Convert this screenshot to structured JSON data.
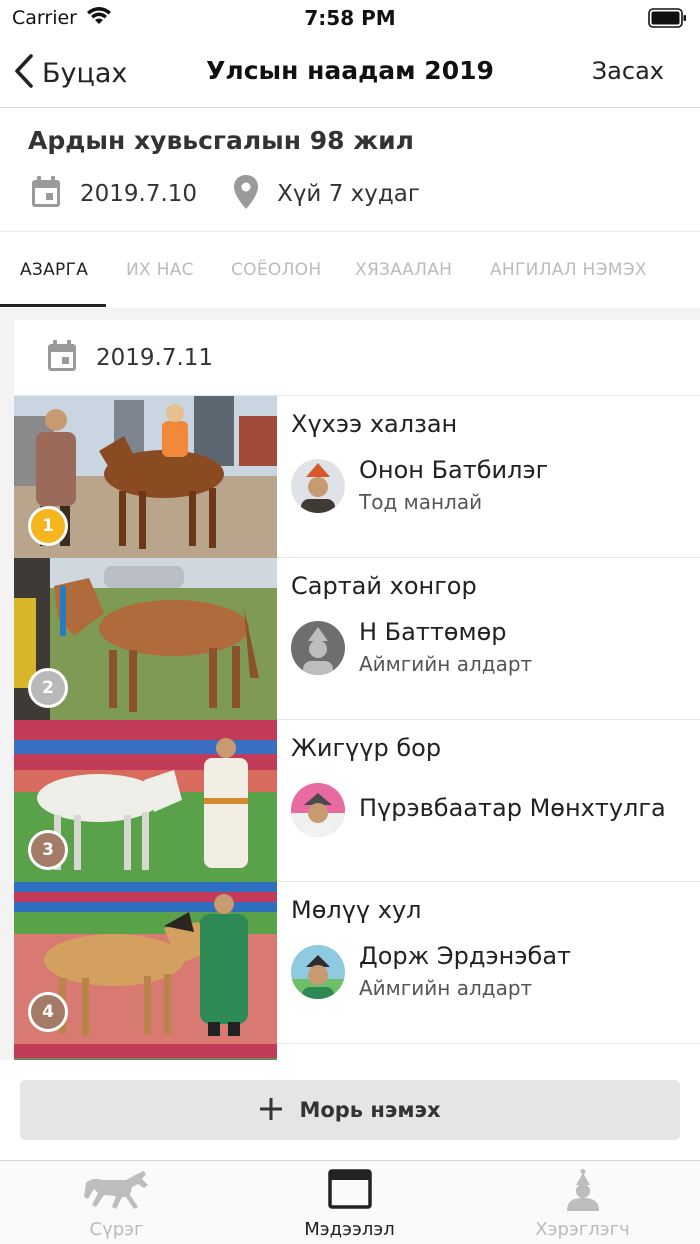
{
  "status_bar": {
    "carrier": "Carrier",
    "time": "7:58 PM"
  },
  "nav": {
    "back_label": "Буцах",
    "title": "Улсын наадам 2019",
    "edit_label": "Засах"
  },
  "event": {
    "title": "Ардын хувьсгалын 98 жил",
    "date": "2019.7.10",
    "location": "Хүй 7 худаг"
  },
  "tabs": [
    {
      "label": "АЗАРГА",
      "active": true
    },
    {
      "label": "ИХ НАС",
      "active": false
    },
    {
      "label": "СОЁОЛОН",
      "active": false
    },
    {
      "label": "ХЯЗААЛАН",
      "active": false
    },
    {
      "label": "АНГИЛАЛ НЭМЭХ",
      "active": false
    }
  ],
  "race": {
    "date": "2019.7.11"
  },
  "results": [
    {
      "place": "1",
      "horse": "Хүхээ халзан",
      "jockey": "Онон Батбилэг",
      "title": "Тод манлай",
      "badge_color": "#f5b51d"
    },
    {
      "place": "2",
      "horse": "Сартай хонгор",
      "jockey": "Н Баттөмөр",
      "title": "Аймгийн алдарт",
      "badge_color": "#b9b9b9"
    },
    {
      "place": "3",
      "horse": "Жигүүр бор",
      "jockey": "Пүрэвбаатар Мөнхтулга",
      "title": "",
      "badge_color": "#a37b67"
    },
    {
      "place": "4",
      "horse": "Мөлүү хул",
      "jockey": "Дорж Эрдэнэбат",
      "title": "Аймгийн алдарт",
      "badge_color": "#a37b67"
    }
  ],
  "add_button": {
    "label": "Морь нэмэх"
  },
  "tab_bar": [
    {
      "label": "Сүрэг",
      "icon": "horse-icon",
      "active": false
    },
    {
      "label": "Мэдээлэл",
      "icon": "browser-window-icon",
      "active": true
    },
    {
      "label": "Хэрэглэгч",
      "icon": "user-icon",
      "active": false
    }
  ]
}
